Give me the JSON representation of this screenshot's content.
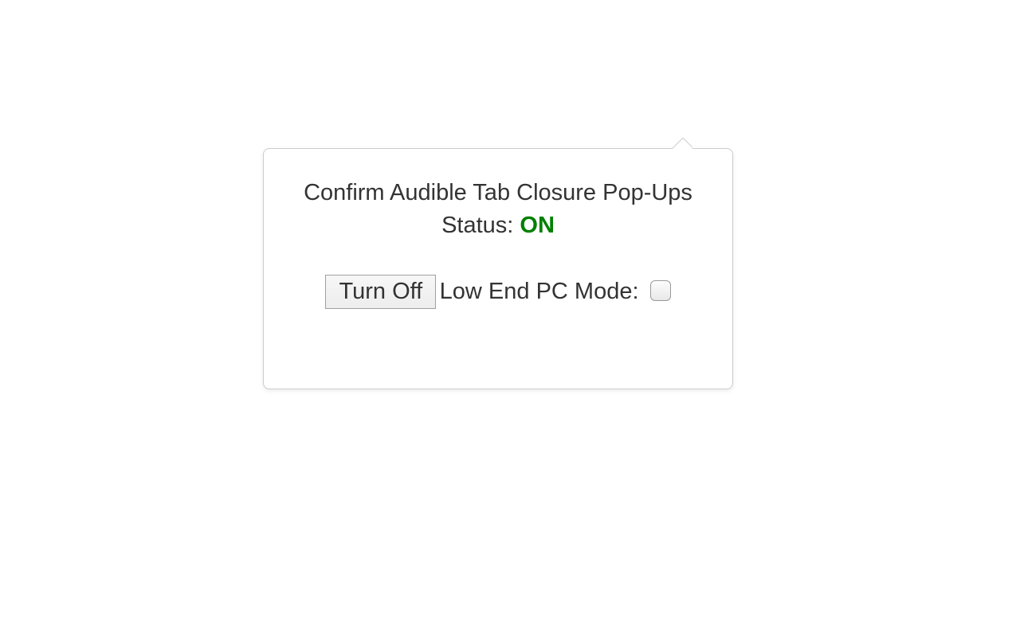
{
  "popup": {
    "status_label_prefix": "Confirm Audible Tab Closure Pop-Ups Status: ",
    "status_value": "ON",
    "toggle_button_label": "Turn Off",
    "low_end_label": "Low End PC Mode:",
    "low_end_checked": false,
    "colors": {
      "status_on": "#008000"
    }
  }
}
